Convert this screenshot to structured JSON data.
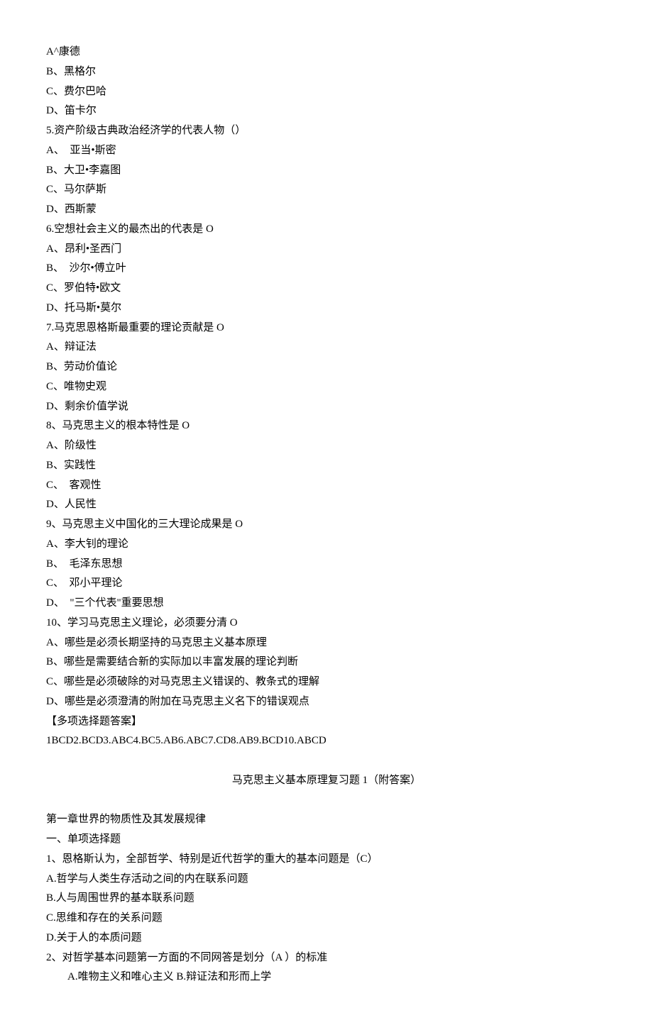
{
  "q4_options": {
    "a": "A^康德",
    "b": "B、黑格尔",
    "c": "C、费尔巴哈",
    "d": "D、笛卡尔"
  },
  "q5": {
    "stem": "5.资产阶级古典政治经济学的代表人物（）",
    "a": "A、　亚当•斯密",
    "b": "B、大卫•李嘉图",
    "c": "C、马尔萨斯",
    "d": "D、西斯蒙"
  },
  "q6": {
    "stem": "6.空想社会主义的最杰出的代表是 O",
    "a": "A、昂利•圣西门",
    "b": "B、　沙尔•傅立叶",
    "c": "C、罗伯特•欧文",
    "d": "D、托马斯•莫尔"
  },
  "q7": {
    "stem": "7.马克思恩格斯最重要的理论贡献是 O",
    "a": "A、辩证法",
    "b": "B、劳动价值论",
    "c": "C、唯物史观",
    "d": "D、剩余价值学说"
  },
  "q8": {
    "stem": "8、马克思主义的根本特性是 O",
    "a": "A、阶级性",
    "b": "B、实践性",
    "c": "C、　客观性",
    "d": "D、人民性"
  },
  "q9": {
    "stem": "9、马克思主义中国化的三大理论成果是 O",
    "a": "A、李大钊的理论",
    "b": "B、　毛泽东思想",
    "c": "C、　邓小平理论",
    "d": "D、　\"三个代表\"重要思想"
  },
  "q10": {
    "stem": "10、学习马克思主义理论，必须要分清 O",
    "a": "A、哪些是必须长期坚持的马克思主义基本原理",
    "b": "B、哪些是需要结合新的实际加以丰富发展的理论判断",
    "c": "C、哪些是必须破除的对马克思主义错误的、教条式的理解",
    "d": "D、哪些是必须澄清的附加在马克思主义名下的错误观点"
  },
  "answer_header": "【多项选择题答案】",
  "answer_line": "1BCD2.BCD3.ABC4.BC5.AB6.ABC7.CD8.AB9.BCD10.ABCD",
  "title2": "马克思主义基本原理复习题 1（附答案）",
  "chapter1": {
    "heading": "第一章世界的物质性及其发展规律",
    "section": "一、单项选择题",
    "q1": {
      "stem": "1、恩格斯认为，全部哲学、特别是近代哲学的重大的基本问题是（C）",
      "a": "A.哲学与人类生存活动之间的内在联系问题",
      "b": "B.人与周围世界的基本联系问题",
      "c": "C.思维和存在的关系问题",
      "d": "D.关于人的本质问题"
    },
    "q2": {
      "stem": "2、对哲学基本问题第一方面的不同网答是划分（A ）的标准",
      "ab": "A.唯物主义和唯心主义 B.辩证法和形而上学"
    }
  }
}
